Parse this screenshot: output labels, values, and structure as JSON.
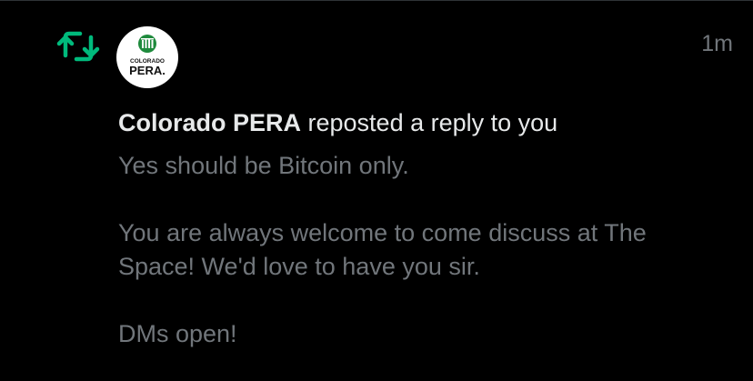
{
  "notification": {
    "type_icon": "repost-icon",
    "accent_color": "#00ba7c",
    "avatar": {
      "icon": "colorado-pera-logo",
      "logo_top": "COLORADO",
      "logo_bottom": "PERA."
    },
    "timestamp": "1m",
    "account_name": "Colorado PERA",
    "action_text": " reposted a reply to you",
    "reply_lines": [
      "Yes should be Bitcoin only.",
      "You are always welcome to come discuss at The Space! We'd love to have you sir.",
      "DMs open!"
    ]
  }
}
